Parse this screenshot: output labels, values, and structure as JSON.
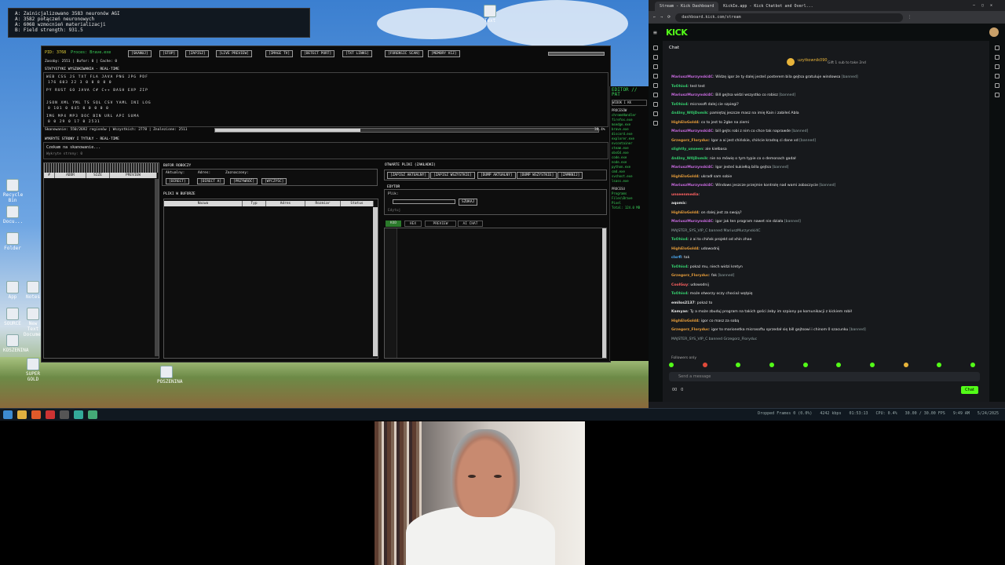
{
  "terminal": {
    "lines": [
      "A: Zainicjalizowano 3583 neuronów AGI",
      "A: 3582 połączeń neuronowych",
      "A: 6068 wzmocnień materializacji",
      "B: Field strength: 931.5"
    ]
  },
  "app": {
    "pid_label": "PID: 3768",
    "proc_label": "Proces: Brave.exe",
    "buttons": [
      "[SKANUJ]",
      "[STOP]",
      "[ZAPISZ]",
      "[LIVE PREVIEW]",
      "[IMAGE TV]",
      "[DETECT PORT]",
      "[TXT LINKS]",
      "[FORENSIC SCAN]",
      "[MEMORY VIZ]"
    ],
    "stats_line": "Zasoby: 2551 | Bufor: 0 | Cache: 0",
    "stats_title": "STATYSTYKI WYSZUKIWANIA - REAL-TIME",
    "stat_rows": [
      [
        "WEB",
        "CSS",
        "JS",
        "TXT",
        "FLA",
        "JAVA",
        "PNG",
        "JPG",
        "PDF"
      ],
      [
        "176",
        "603",
        "22",
        "3",
        "0",
        "0",
        "8",
        "0",
        "0"
      ],
      [
        "PY",
        "RUST",
        "GO",
        "JAVA",
        "C#",
        "C++",
        "BASH",
        "EXP",
        "ZIP"
      ],
      [
        "JSON",
        "XML",
        "YML",
        "TS",
        "SQL",
        "CSV",
        "YAML",
        "INI",
        "LOG"
      ],
      [
        "0",
        "101",
        "0",
        "645",
        "0",
        "0",
        "0",
        "0",
        "0"
      ],
      [
        "IMG",
        "MP4",
        "MP3",
        "DOC",
        "BIN",
        "URL",
        "API",
        "SUMA"
      ],
      [
        "0",
        "0",
        "29",
        "0",
        "17",
        "0",
        "2531"
      ]
    ],
    "scan_line": "Skanowanie: 550/2692 regionów | Wszystkich: 2778 | Znalezione: 2511",
    "percent": "38.4%",
    "progress": 0.38,
    "links_title": "WYKRYTE STRONY I TYTUŁY - REAL-TIME",
    "waiting": "Czekam na skanowanie...",
    "detected": "Wykryte strony: 0",
    "buffer_title": "BUFOR ROBOCZY",
    "buffer_status": [
      "Aktualny:",
      "Adres:",
      "Zaznaczony:"
    ],
    "buffer_buttons": [
      "[DIRECT]",
      "[DIRECT A]",
      "[PRZYWRÓĆ]",
      "[WYCZYŚĆ]"
    ],
    "left_headers": [
      "#",
      "ADDR",
      "SIZE",
      "PREVIEW"
    ],
    "files_title": "PLIKI W BUFORZE",
    "file_headers": [
      "Nazwa",
      "Typ",
      "Adres",
      "Rozmiar",
      "Status"
    ],
    "open_title": "OTWARTE PLIKI (ZAKŁADKI)",
    "open_buttons": [
      "[ZAPISZ AKTUALNY]",
      "[ZAPISZ WSZYSTKIE]",
      "[DUMP AKTUALNY]",
      "[DUMP WSZYSTKIE]",
      "[ZAMKNIJ]"
    ],
    "editor_title": "EDYTOR",
    "find_label": "Plik:",
    "find_button": "SZUKAJ",
    "find_hint": "Edytuj",
    "tabs": [
      "KOD",
      "HEX",
      "PREVIEW",
      "AI CHAT"
    ]
  },
  "side_app": {
    "title": "EDITOR // PAT",
    "list": [
      "WIDOK I KK",
      "PROCESÓW",
      "chromeHandler",
      "firefox.exe",
      "msedge.exe",
      "brave.exe",
      "discord.exe",
      "explorer.exe",
      "nvcontainer",
      "steam.exe",
      "obs64.exe",
      "code.exe",
      "node.exe",
      "python.exe",
      "cmd.exe",
      "svchost.exe",
      "lsass.exe"
    ],
    "footer": "PROCESU",
    "extra": [
      "Programs Files\\Brave",
      "Pixel",
      "Total: 124.0 MB"
    ]
  },
  "browser": {
    "tabs": [
      "Stream - Kick Dashboard",
      "KickIe.app - Kick Chatbot and Overl..."
    ],
    "url": "dashboard.kick.com/stream",
    "logo": "KICK",
    "chat_title": "Chat",
    "gift": "Gift 1 sub to take 2nd",
    "gifter": "uzytkownik090",
    "messages": [
      {
        "u": "MariuszMurzynski4C",
        "c": "u1",
        "t": "Widzę igor że ty dalej jesteś posterem bila gejtsa gratuluje windowsa",
        "b": " [banned]"
      },
      {
        "u": "ToOhio4",
        "c": "u2",
        "t": "test test",
        "b": ""
      },
      {
        "u": "MariuszMurzynski4C",
        "c": "u1",
        "t": "Bill gejtsa widzi wszystko co robisz",
        "b": " [banned]"
      },
      {
        "u": "ToOhio4",
        "c": "u2",
        "t": "microsoft dalej cie szpiegi?",
        "b": ""
      },
      {
        "u": "4n4lny_W0jDomik",
        "c": "u2",
        "t": "pamiętaj jeszcze masz na imię Kain i zabiłeś Abla",
        "b": ""
      },
      {
        "u": "HighEloGold4",
        "c": "u3",
        "t": "co to jest to 2gbe na ziemi",
        "b": ""
      },
      {
        "u": "MariuszMurzynski4C",
        "c": "u1",
        "t": "bill gejts robi z nim co chce tak naprawde",
        "b": " [banned]"
      },
      {
        "u": "Grzegorz_Floryduc",
        "c": "u3",
        "t": "Igor a ai jest chińskie, chińcie kradną ci dane xd",
        "b": " [banned]"
      },
      {
        "u": "slightly_unseen",
        "c": "u2",
        "t": "ale kiełbasa",
        "b": ""
      },
      {
        "u": "4n4lny_W0jDomik",
        "c": "u2",
        "t": "nie no mówię o tym typie co o demonach gadał",
        "b": ""
      },
      {
        "u": "MariuszMurzynski4C",
        "c": "u1",
        "t": "Igor jesteś kukiełką billa gejtsa",
        "b": " [banned]"
      },
      {
        "u": "HighEloGold4",
        "c": "u3",
        "t": "ukradł sam sobie",
        "b": ""
      },
      {
        "u": "MariuszMurzynski4C",
        "c": "u1",
        "t": "Windows jeszcze przejmie kontrolę nad wami zobaczycie",
        "b": " [banned]"
      },
      {
        "u": "unseenmedia",
        "c": "u5",
        "t": "",
        "b": ""
      },
      {
        "u": "aqomic",
        "c": "u4",
        "t": "",
        "b": ""
      },
      {
        "u": "HighEloGold4",
        "c": "u3",
        "t": "on dalej jest za swoją?",
        "b": ""
      },
      {
        "u": "MariuszMurzynski4C",
        "c": "u1",
        "t": "igor jak ten program nawet nie działa",
        "b": " [banned]"
      },
      {
        "u": "",
        "c": "u4",
        "t": "MAJSTER_SYS_VIP_C banned MariuszMurzynski4C",
        "b": ""
      },
      {
        "u": "ToOhio4",
        "c": "u2",
        "t": "z ai to chińsk projekt od xhin zhao",
        "b": ""
      },
      {
        "u": "HighEloGold4",
        "c": "u3",
        "t": "udowodnij",
        "b": ""
      },
      {
        "u": "clxrfl",
        "c": "u6",
        "t": "tak",
        "b": ""
      },
      {
        "u": "ToOhio4",
        "c": "u2",
        "t": "pokaż mu, niech widzi kretyn",
        "b": ""
      },
      {
        "u": "Grzegorz_Floryduc",
        "c": "u3",
        "t": "fak",
        "b": " [banned]"
      },
      {
        "u": "CoolGuy",
        "c": "u5",
        "t": "udowodnij",
        "b": ""
      },
      {
        "u": "ToOhio4",
        "c": "u2",
        "t": "może otworzy oczy chociaż wątpię",
        "b": ""
      },
      {
        "u": "emilos2137",
        "c": "u4",
        "t": "pokaż to",
        "b": ""
      },
      {
        "u": "Kamyan",
        "c": "u4",
        "t": "Ty a może zbuduj program na takich gości żeby im szpiony po komunikacji z kickiem robił",
        "b": ""
      },
      {
        "u": "HighEloGold4",
        "c": "u3",
        "t": "igor co masz za sobą",
        "b": ""
      },
      {
        "u": "Grzegorz_Floryduc",
        "c": "u3",
        "t": "igor to marionetka microsoftu sprzedał się bill gejtsowi i chinom 0 szacunku",
        "b": " [banned]"
      },
      {
        "u": "",
        "c": "u4",
        "t": "MAJSTER_SYS_VIP_C banned Grzegorz_Floryduc",
        "b": ""
      }
    ],
    "followers": "Followers only",
    "input_placeholder": "Send a message",
    "chat_button": "Chat",
    "counts": [
      "00",
      "0"
    ]
  },
  "obs": {
    "dropped": "Dropped Frames 0 (0.0%)",
    "kbps": "4242 kbps",
    "time": "01:53:13",
    "cpu": "CPU: 0.4%",
    "fps": "30.00 / 30.00 FPS",
    "clock": "9:49 AM",
    "date": "5/24/2025"
  },
  "desktop": {
    "icons": [
      "Recycle Bin",
      "Docu...",
      "Folder",
      "App",
      "Notes",
      "SOURCE",
      "New Text Document",
      "KOSZENINA",
      "SUPER GOLD",
      "POSZENINA",
      "Text"
    ]
  }
}
